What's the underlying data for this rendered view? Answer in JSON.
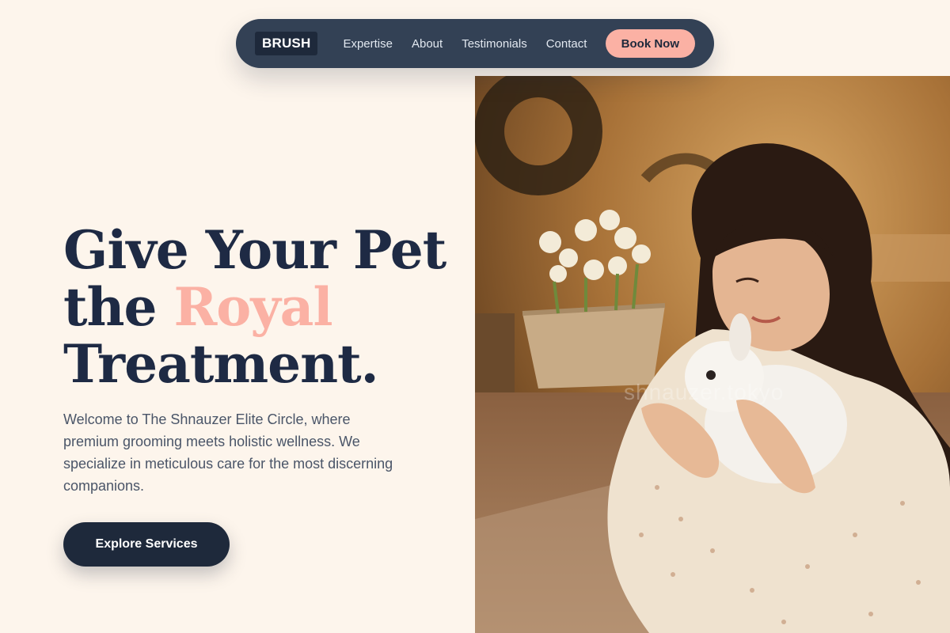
{
  "nav": {
    "logo": "BRUSH",
    "links": [
      "Expertise",
      "About",
      "Testimonials",
      "Contact"
    ],
    "book_label": "Book Now"
  },
  "hero": {
    "title_line1": "Give Your Pet",
    "title_the": "the",
    "title_accent": "Royal",
    "title_line3": "Treatment.",
    "description": "Welcome to The Shnauzer Elite Circle, where premium grooming meets holistic wellness. We specialize in meticulous care for the most discerning companions.",
    "cta_label": "Explore Services"
  },
  "image": {
    "watermark": "shnauzer.tokyo"
  },
  "colors": {
    "background": "#fdf5ec",
    "nav": "#334155",
    "primary": "#1e293b",
    "accent": "#fbb1a4"
  }
}
